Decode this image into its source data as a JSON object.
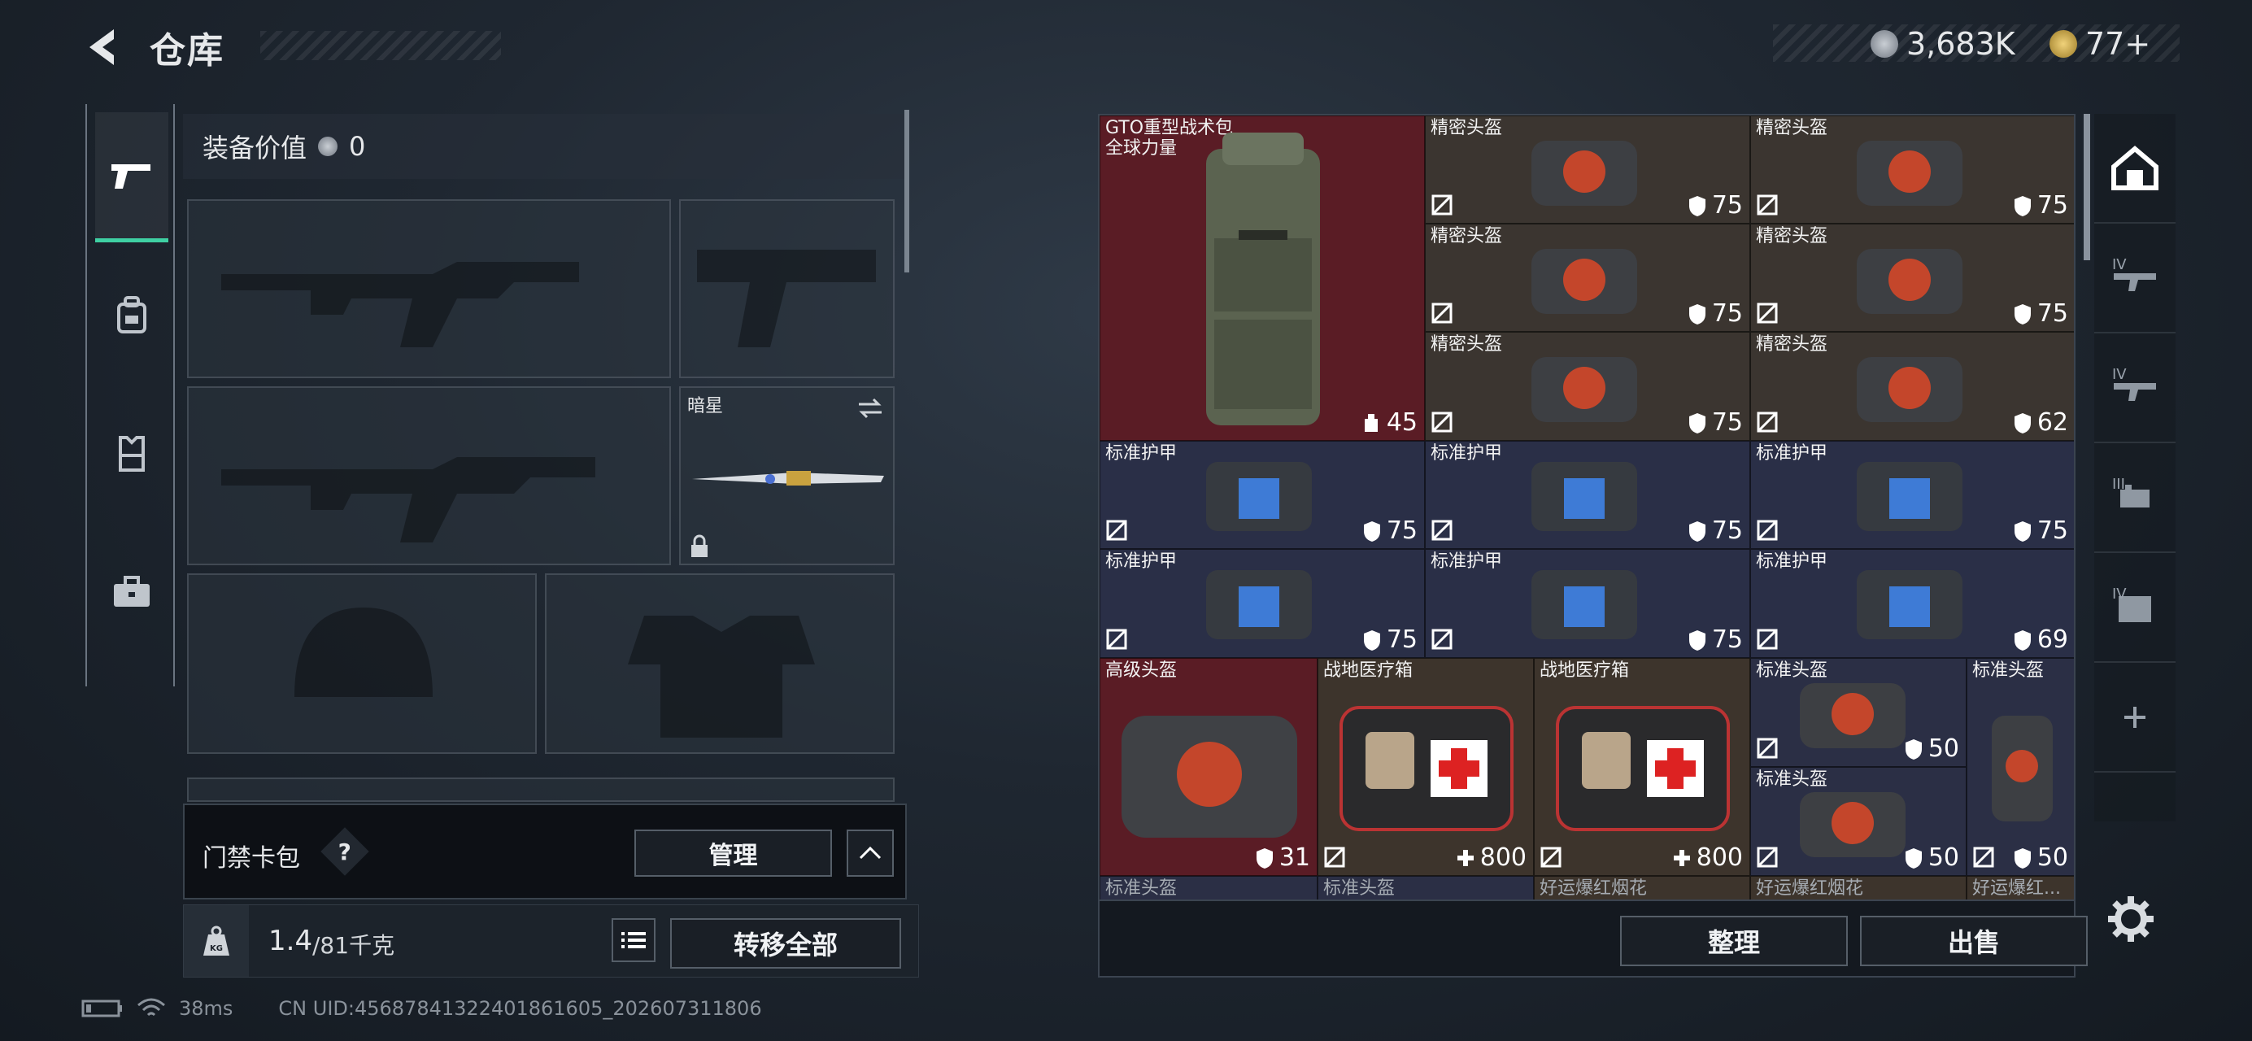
{
  "header": {
    "title": "仓库",
    "currency_primary": "3,683K",
    "currency_secondary": "77+"
  },
  "colors": {
    "accent": "#3fd0a3",
    "rare_red": "#5a1c25",
    "armor_blue": "#2a2f47"
  },
  "left_nav": {
    "items": [
      {
        "icon": "pistol-icon"
      },
      {
        "icon": "backpack-icon"
      },
      {
        "icon": "vest-icon"
      },
      {
        "icon": "briefcase-icon"
      }
    ]
  },
  "loadout": {
    "equip_value_label": "装备价值",
    "equip_value": "0",
    "melee_name": "暗星"
  },
  "card_pack": {
    "label": "门禁卡包",
    "help": "?",
    "manage_label": "管理"
  },
  "weight": {
    "current": "1.4",
    "max": "/81千克",
    "transfer_all_label": "转移全部"
  },
  "grid": {
    "backpack": {
      "name": "GTO重型战术包",
      "sub": "全球力量",
      "capacity": "45"
    },
    "helmets_precision": [
      {
        "name": "精密头盔",
        "value": "75"
      },
      {
        "name": "精密头盔",
        "value": "75"
      },
      {
        "name": "精密头盔",
        "value": "75"
      },
      {
        "name": "精密头盔",
        "value": "75"
      },
      {
        "name": "精密头盔",
        "value": "75"
      },
      {
        "name": "精密头盔",
        "value": "62"
      }
    ],
    "armors": [
      {
        "name": "标准护甲",
        "value": "75"
      },
      {
        "name": "标准护甲",
        "value": "75"
      },
      {
        "name": "标准护甲",
        "value": "75"
      },
      {
        "name": "标准护甲",
        "value": "75"
      },
      {
        "name": "标准护甲",
        "value": "75"
      },
      {
        "name": "标准护甲",
        "value": "69"
      }
    ],
    "bottom_row": [
      {
        "name": "高级头盔",
        "value": "31"
      },
      {
        "name": "战地医疗箱",
        "value": "800"
      },
      {
        "name": "战地医疗箱",
        "value": "800"
      }
    ],
    "std_helmets": [
      {
        "name": "标准头盔",
        "value": "50"
      },
      {
        "name": "标准头盔",
        "value": "50"
      },
      {
        "name": "标准头盔",
        "value": "50"
      }
    ],
    "peek_row": [
      "标准头盔",
      "标准头盔",
      "好运爆红烟花",
      "好运爆红烟花",
      "好运爆红..."
    ]
  },
  "actions": {
    "sort_label": "整理",
    "sell_label": "出售"
  },
  "cat_nav": {
    "labels": [
      "IV",
      "IV",
      "III",
      "IV"
    ]
  },
  "status": {
    "ping": "38ms",
    "uid": "CN UID:45687841322401861605_202607311806"
  }
}
